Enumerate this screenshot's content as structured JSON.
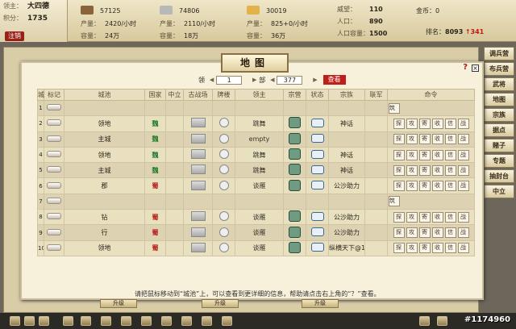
{
  "player": {
    "label": "领主：",
    "name": "大四德",
    "score_label": "积分：",
    "score": "1735",
    "logout": "注销"
  },
  "resources": [
    {
      "name": "粮食",
      "amount": "57125",
      "prod_label": "产量：",
      "prod": "2420/小时",
      "cap_label": "容量：",
      "cap": "24万",
      "icon_color": "#8b633a"
    },
    {
      "name": "石材",
      "amount": "74806",
      "prod_label": "产量：",
      "prod": "2110/小时",
      "cap_label": "容量：",
      "cap": "18万",
      "icon_color": "#b8b8b8"
    },
    {
      "name": "金钱",
      "amount": "30019",
      "prod_label": "产量：",
      "prod": "825+0/小时",
      "cap_label": "容量：",
      "cap": "36万",
      "icon_color": "#e3b34a"
    }
  ],
  "stats": {
    "prestige_label": "威望：",
    "prestige": "110",
    "population_label": "人口：",
    "population": "890",
    "pop_cap_label": "人口容量：",
    "pop_cap": "1500"
  },
  "gold": {
    "label": "金币：",
    "value": "0"
  },
  "rank": {
    "label": "排名：",
    "value": "8093",
    "delta": "↑341"
  },
  "right_menu": [
    "调兵营",
    "布兵营",
    "武将",
    "地图",
    "宗族",
    "据点",
    "赌子",
    "专题",
    "抽封台",
    "中立"
  ],
  "modal": {
    "title": "地图",
    "help": "?",
    "close": "×",
    "pager": {
      "page_label": "领",
      "page": "1",
      "section_label": "部",
      "section": "377",
      "view": "查看"
    },
    "headers": [
      "城",
      "标记",
      "城池",
      "国家",
      "中立",
      "古战场",
      "牌楼",
      "领主",
      "宗营",
      "状态",
      "宗族",
      "联军",
      "命令"
    ],
    "rows": [
      {
        "n": "1",
        "city": "",
        "country": "",
        "country_class": "",
        "leader": "",
        "tribe": "",
        "has_cmd": "empty"
      },
      {
        "n": "2",
        "city": "领地",
        "country": "魏",
        "country_class": "wei",
        "leader": "跳舞",
        "tribe": "神话",
        "has_cmd": "full"
      },
      {
        "n": "3",
        "city": "主城",
        "country": "魏",
        "country_class": "wei",
        "leader": "empty",
        "tribe": "",
        "has_cmd": "full"
      },
      {
        "n": "4",
        "city": "领地",
        "country": "魏",
        "country_class": "wei",
        "leader": "跳舞",
        "tribe": "神话",
        "has_cmd": "full"
      },
      {
        "n": "5",
        "city": "主城",
        "country": "魏",
        "country_class": "wei",
        "leader": "跳舞",
        "tribe": "神话",
        "has_cmd": "full"
      },
      {
        "n": "6",
        "city": "郡",
        "country": "蜀",
        "country_class": "shu",
        "leader": "谈雁",
        "tribe": "公沙助力",
        "has_cmd": "full"
      },
      {
        "n": "7",
        "city": "",
        "country": "",
        "country_class": "",
        "leader": "",
        "tribe": "",
        "has_cmd": "empty"
      },
      {
        "n": "8",
        "city": "钻",
        "country": "蜀",
        "country_class": "shu",
        "leader": "谈雁",
        "tribe": "公沙助力",
        "has_cmd": "full"
      },
      {
        "n": "9",
        "city": "行",
        "country": "蜀",
        "country_class": "shu",
        "leader": "谈雁",
        "tribe": "公沙助力",
        "has_cmd": "full"
      },
      {
        "n": "10",
        "city": "领地",
        "country": "蜀",
        "country_class": "shu",
        "leader": "谈雁",
        "tribe": "纵横天下@1",
        "has_cmd": "full"
      }
    ],
    "commands": [
      "探",
      "攻",
      "寄",
      "收",
      "信",
      "战"
    ],
    "empty_command": "筑",
    "footer": "请把鼠标移动到“城池”上，可以查看到更详细的信息，帮助请点击右上角的“？”查看。"
  },
  "upgrade_label": "升级",
  "watermark": "#1174960"
}
